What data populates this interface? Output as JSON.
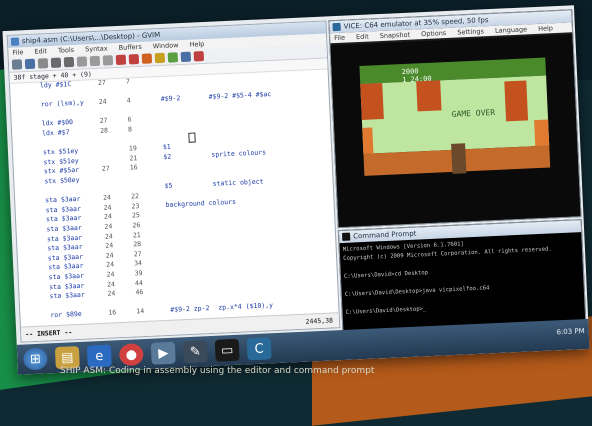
{
  "editor": {
    "title": "ship4.asm (C:\\Users\\...\\Desktop) - GVIM",
    "menu": [
      "File",
      "Edit",
      "Tools",
      "Syntax",
      "Buffers",
      "Window",
      "Help"
    ],
    "command_line": "38f  stage + 40 + (9)",
    "lines": [
      {
        "op": "ldy #$1C",
        "a": "27",
        "b": "7",
        "c": "",
        "d": ""
      },
      {
        "op": "",
        "a": "",
        "b": "",
        "c": "",
        "d": ""
      },
      {
        "op": "ror (lsm),y",
        "a": "24",
        "b": "4",
        "c": "#$9-2",
        "d": "#$9-2   #$5-4   #$ac"
      },
      {
        "op": "",
        "a": "",
        "b": "",
        "c": "",
        "d": ""
      },
      {
        "op": "ldx #$00",
        "a": "27",
        "b": "6",
        "c": "",
        "d": ""
      },
      {
        "op": "ldx #$7",
        "a": "28",
        "b": "8",
        "c": "",
        "d": ""
      },
      {
        "op": "",
        "a": "",
        "b": "",
        "c": "",
        "d": ""
      },
      {
        "op": "stx $51ey",
        "a": "",
        "b": "19",
        "c": "$1",
        "d": ""
      },
      {
        "op": "stx $51ey",
        "a": "",
        "b": "21",
        "c": "$2",
        "d": "sprite colours"
      },
      {
        "op": "stx #$5ar",
        "a": "27",
        "b": "16",
        "c": "",
        "d": ""
      },
      {
        "op": "stx $50ey",
        "a": "",
        "b": "",
        "c": "",
        "d": ""
      },
      {
        "op": "",
        "a": "",
        "b": "",
        "c": "$5",
        "d": "static object"
      },
      {
        "op": "sta $3aar",
        "a": "24",
        "b": "22",
        "c": "",
        "d": ""
      },
      {
        "op": "sta $3aar",
        "a": "24",
        "b": "23",
        "c": "background colours",
        "d": ""
      },
      {
        "op": "sta $3aar",
        "a": "24",
        "b": "25",
        "c": "",
        "d": ""
      },
      {
        "op": "sta $3aar",
        "a": "24",
        "b": "26",
        "c": "",
        "d": ""
      },
      {
        "op": "sta $3aar",
        "a": "24",
        "b": "21",
        "c": "",
        "d": ""
      },
      {
        "op": "sta $3aar",
        "a": "24",
        "b": "28",
        "c": "",
        "d": ""
      },
      {
        "op": "sta $3aar",
        "a": "24",
        "b": "27",
        "c": "",
        "d": ""
      },
      {
        "op": "sta $3aar",
        "a": "24",
        "b": "34",
        "c": "",
        "d": ""
      },
      {
        "op": "sta $3aar",
        "a": "24",
        "b": "39",
        "c": "",
        "d": ""
      },
      {
        "op": "sta $3aar",
        "a": "24",
        "b": "44",
        "c": "",
        "d": ""
      },
      {
        "op": "sta $3aar",
        "a": "24",
        "b": "46",
        "c": "",
        "d": ""
      },
      {
        "op": "",
        "a": "",
        "b": "",
        "c": "",
        "d": ""
      },
      {
        "op": "ror $89e",
        "a": "16",
        "b": "14",
        "c": "#$9-2  zp-2",
        "d": "zp.x*4 ($10),y"
      }
    ],
    "status_mode": "-- INSERT --",
    "status_pos": "2445,38"
  },
  "emulator": {
    "title": "VICE: C64 emulator at 35% speed, 50 fps",
    "menu": [
      "File",
      "Edit",
      "Snapshot",
      "Options",
      "Settings",
      "Language",
      "Help"
    ],
    "score_line1": "2000",
    "score_line2": "1 24:00",
    "game_over": "GAME OVER"
  },
  "command_prompt": {
    "title": "Command Prompt",
    "lines": [
      "Microsoft Windows [Version 6.1.7601]",
      "Copyright (c) 2009 Microsoft Corporation.  All rights reserved.",
      "",
      "C:\\Users\\David>cd Desktop",
      "",
      "C:\\Users\\David\\Desktop>java vicpixelfoo.c64",
      "",
      "C:\\Users\\David\\Desktop>_"
    ]
  },
  "taskbar": {
    "clock": "6:03 PM"
  },
  "caption": "SHIP ASM: Coding in assembly using the editor and command prompt"
}
